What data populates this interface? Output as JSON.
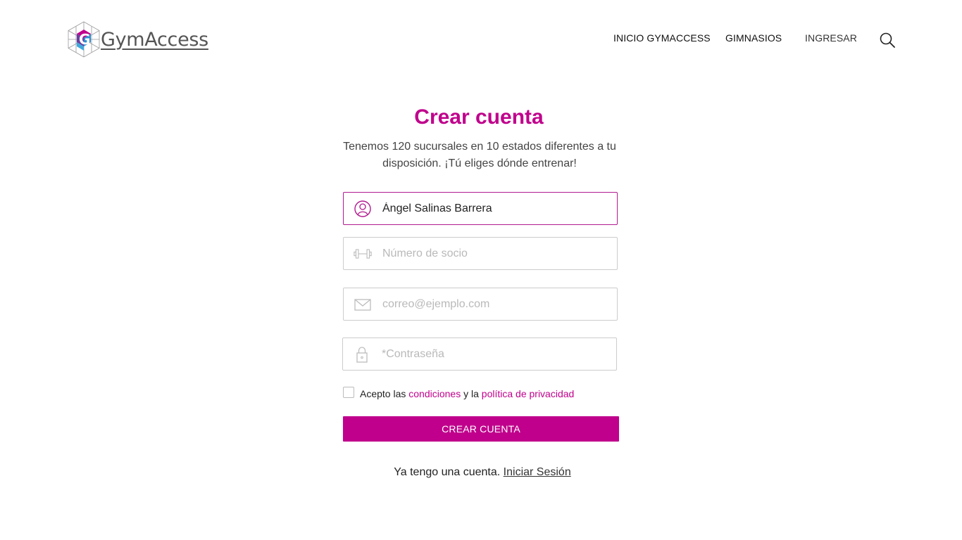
{
  "brand": {
    "name": "GymAccess",
    "colors": {
      "accent": "#c0008c",
      "mark_blue": "#2f8fd0",
      "mark_purple": "#6a3fa0",
      "mark_magenta": "#c0008c"
    }
  },
  "nav": {
    "items": [
      {
        "label": "INICIO GYMACCESS"
      },
      {
        "label": "GIMNASIOS"
      },
      {
        "label": "INGRESAR"
      }
    ],
    "search_icon": "search-icon"
  },
  "form": {
    "title": "Crear cuenta",
    "subtitle": "Tenemos 120 sucursales en 10 estados diferentes a tu disposición. ¡Tú eliges dónde entrenar!",
    "fields": {
      "name": {
        "icon": "user-icon",
        "value": "Ángel Salinas Barrera",
        "placeholder": ""
      },
      "member_number": {
        "icon": "dumbbell-icon",
        "value": "",
        "placeholder": "Número de socio"
      },
      "email": {
        "icon": "envelope-icon",
        "value": "",
        "placeholder": "correo@ejemplo.com"
      },
      "password": {
        "icon": "lock-icon",
        "value": "",
        "placeholder": "*Contraseña"
      }
    },
    "terms": {
      "prefix": "Acepto las",
      "conditions_link": "condiciones",
      "middle": "y la",
      "privacy_link": "política de privacidad",
      "checked": false
    },
    "submit_label": "CREAR CUENTA",
    "login_prompt": "Ya tengo una cuenta.",
    "login_link": "Iniciar Sesión"
  }
}
